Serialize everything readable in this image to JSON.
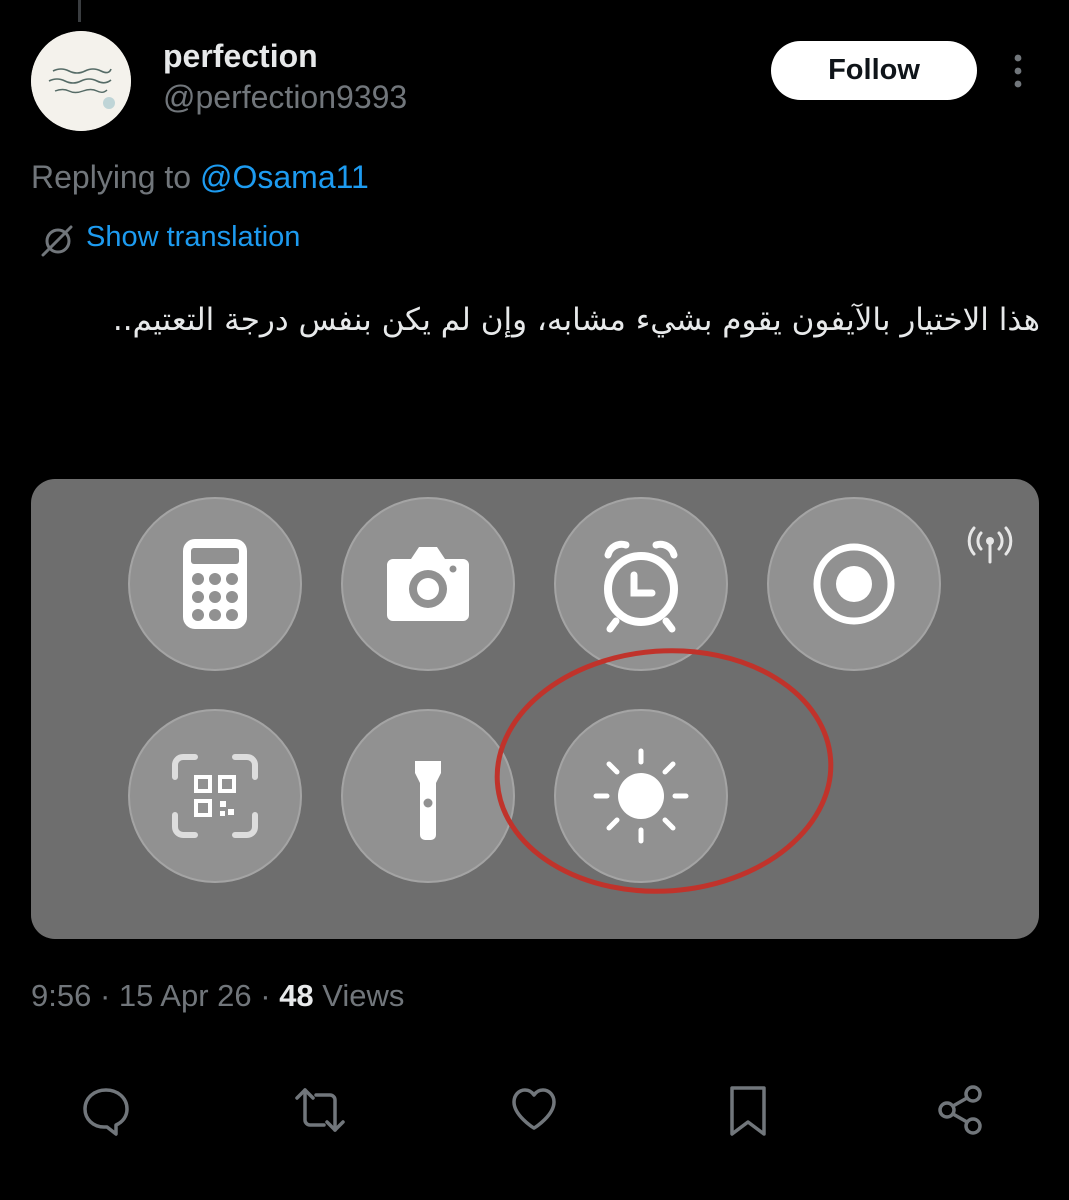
{
  "tweet": {
    "display_name": "perfection",
    "handle": "@perfection9393",
    "follow_label": "Follow",
    "replying_prefix": "Replying to ",
    "replying_to": "@Osama11",
    "translate_label": "Show translation",
    "text": "هذا الاختيار بالآيفون يقوم بشيء مشابه، وإن لم يكن بنفس درجة التعتيم..",
    "time": "9:56",
    "date": "15 Apr 26",
    "views_count": "48",
    "views_label": "Views"
  },
  "media": {
    "icons": [
      "calculator-icon",
      "camera-icon",
      "alarm-clock-icon",
      "screen-record-icon",
      "qr-scan-icon",
      "flashlight-icon",
      "brightness-icon",
      "signal-icon"
    ],
    "highlight_color": "#c0332b"
  },
  "actions": [
    "reply-icon",
    "retweet-icon",
    "like-icon",
    "bookmark-icon",
    "share-icon"
  ],
  "colors": {
    "background": "#000000",
    "accent": "#1d9bf0",
    "muted": "#71767b"
  }
}
